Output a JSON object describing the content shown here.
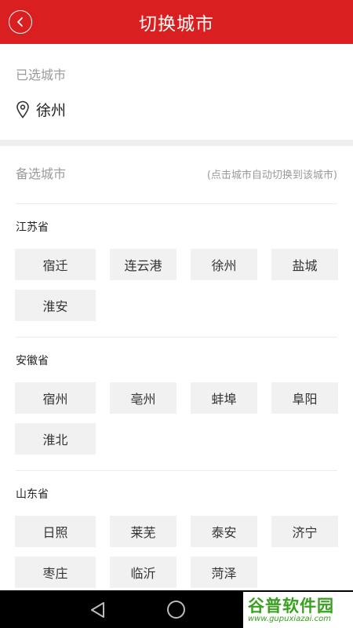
{
  "header": {
    "title": "切换城市"
  },
  "selected": {
    "label": "已选城市",
    "city": "徐州"
  },
  "candidates": {
    "title": "备选城市",
    "hint": "(点击城市自动切换到该城市)",
    "provinces": [
      {
        "name": "江苏省",
        "cities": [
          "宿迁",
          "连云港",
          "徐州",
          "盐城",
          "淮安"
        ]
      },
      {
        "name": "安徽省",
        "cities": [
          "宿州",
          "亳州",
          "蚌埠",
          "阜阳",
          "淮北"
        ]
      },
      {
        "name": "山东省",
        "cities": [
          "日照",
          "莱芜",
          "泰安",
          "济宁",
          "枣庄",
          "临沂",
          "菏泽"
        ]
      }
    ]
  },
  "watermark": {
    "brand": "谷普软件园",
    "url": "www.gupuxiazai.com"
  },
  "colors": {
    "accent": "#d91f1f",
    "chip": "#f1f1f1",
    "watermark": "#38a11d"
  }
}
